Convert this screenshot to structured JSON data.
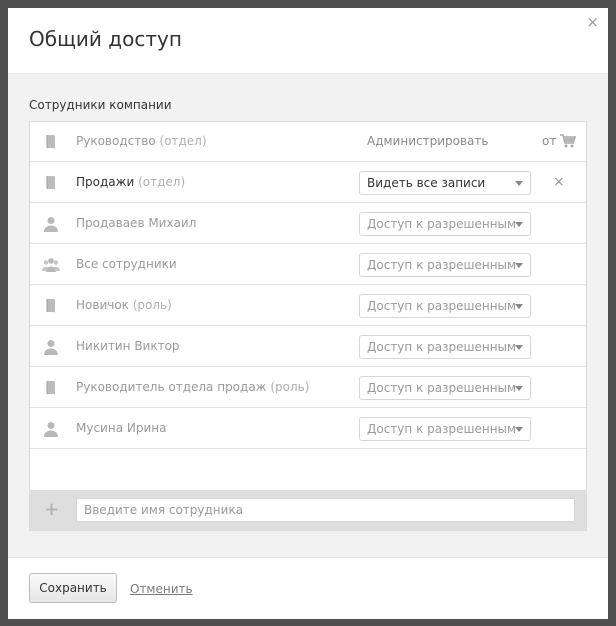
{
  "dialog": {
    "title": "Общий доступ",
    "close_glyph": "×"
  },
  "section_label": "Сотрудники компании",
  "table_header": {
    "name": "Руководство",
    "suffix": "(отдел)",
    "icon": "book-icon",
    "permission_label": "Администрировать",
    "from_label": "от",
    "cart_icon": "cart-icon"
  },
  "rows": [
    {
      "name": "Продажи",
      "suffix": "(отдел)",
      "icon": "book-icon",
      "permission": "Видеть все записи",
      "active": true,
      "remove": "×"
    },
    {
      "name": "Продаваев Михаил",
      "suffix": "",
      "icon": "user-icon",
      "permission": "Доступ к разрешенным"
    },
    {
      "name": "Все сотрудники",
      "suffix": "",
      "icon": "users-icon",
      "permission": "Доступ к разрешенным"
    },
    {
      "name": "Новичок",
      "suffix": "(роль)",
      "icon": "book-icon",
      "permission": "Доступ к разрешенным"
    },
    {
      "name": "Никитин Виктор",
      "suffix": "",
      "icon": "user-icon",
      "permission": "Доступ к разрешенным"
    },
    {
      "name": "Руководитель отдела продаж",
      "suffix": "(роль)",
      "icon": "book-icon",
      "permission": "Доступ к разрешенным"
    },
    {
      "name": "Мусина Ирина",
      "suffix": "",
      "icon": "user-icon",
      "permission": "Доступ к разрешенным"
    }
  ],
  "add_employee": {
    "plus": "+",
    "placeholder": "Введите имя сотрудника"
  },
  "footer": {
    "save_label": "Сохранить",
    "cancel_label": "Отменить"
  }
}
